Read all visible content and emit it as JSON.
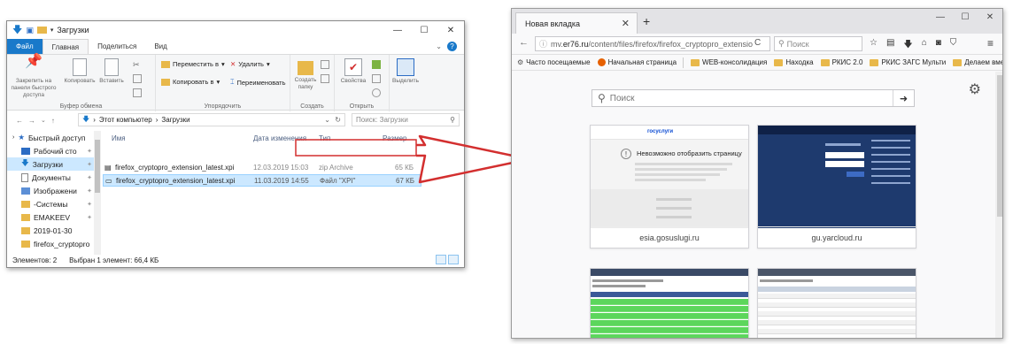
{
  "explorer": {
    "title": "Загрузки",
    "window_controls": [
      "—",
      "☐",
      "✕"
    ],
    "ribbon_tabs": [
      {
        "label": "Файл"
      },
      {
        "label": "Главная"
      },
      {
        "label": "Поделиться"
      },
      {
        "label": "Вид"
      }
    ],
    "ribbon": {
      "clipboard": {
        "pin_label": "Закрепить на панели быстрого доступа",
        "copy_label": "Копировать",
        "paste_label": "Вставить",
        "group_label": "Буфер обмена"
      },
      "organize": {
        "move_to": "Переместить в",
        "copy_to": "Копировать в",
        "delete": "Удалить",
        "rename": "Переименовать",
        "group_label": "Упорядочить"
      },
      "create": {
        "new_folder": "Создать папку",
        "group_label": "Создать"
      },
      "open": {
        "properties": "Свойства",
        "group_label": "Открыть"
      },
      "select": {
        "select_label": "Выделить"
      }
    },
    "address": {
      "path_root": "Этот компьютер",
      "path_leaf": "Загрузки",
      "search_placeholder": "Поиск: Загрузки"
    },
    "nav_items": [
      {
        "label": "Быстрый доступ",
        "pinned": false
      },
      {
        "label": "Рабочий сто",
        "pinned": true
      },
      {
        "label": "Загрузки",
        "pinned": true
      },
      {
        "label": "Документы",
        "pinned": true
      },
      {
        "label": "Изображени",
        "pinned": true
      },
      {
        "label": "-Системы",
        "pinned": true
      },
      {
        "label": "EMAKEEV",
        "pinned": true
      },
      {
        "label": "2019-01-30",
        "pinned": false
      },
      {
        "label": "firefox_cryptopro",
        "pinned": false
      }
    ],
    "columns": {
      "name": "Имя",
      "date": "Дата изменения",
      "type": "Тип",
      "size": "Размер"
    },
    "files": [
      {
        "name": "firefox_cryptopro_extension_latest.xpi",
        "date": "12.03.2019 15:03",
        "type": "zip Archive",
        "size": "65 КБ"
      },
      {
        "name": "firefox_cryptopro_extension_latest.xpi",
        "date": "11.03.2019 14:55",
        "type": "Файл \"XPI\"",
        "size": "67 КБ"
      }
    ],
    "status": {
      "count": "Элементов: 2",
      "selected": "Выбран 1 элемент: 66,4 КБ"
    }
  },
  "firefox": {
    "tab_title": "Новая вкладка",
    "window_controls": [
      "—",
      "☐",
      "✕"
    ],
    "url_prefix": "mv.",
    "url_host": "er76.ru",
    "url_path": "/content/files/firefox/firefox_cryptopro_extensio",
    "search_placeholder": "Поиск",
    "bookmarks": [
      {
        "label": "Часто посещаемые",
        "kind": "gear"
      },
      {
        "label": "Начальная страница",
        "kind": "firefox"
      },
      {
        "label": "WEB-консолидация",
        "kind": "folder"
      },
      {
        "label": "Находка",
        "kind": "folder"
      },
      {
        "label": "РКИС 2.0",
        "kind": "folder"
      },
      {
        "label": "РКИС ЗАГС Мульти",
        "kind": "folder"
      },
      {
        "label": "Делаем вместе",
        "kind": "folder"
      }
    ],
    "newtab_search_placeholder": "Поиск",
    "tiles": [
      {
        "caption": "esia.gosuslugi.ru",
        "error_text": "Невозможно отобразить страницу",
        "logo": "госуслуги"
      },
      {
        "caption": "gu.yarcloud.ru"
      },
      {
        "caption": ""
      },
      {
        "caption": ""
      }
    ]
  }
}
